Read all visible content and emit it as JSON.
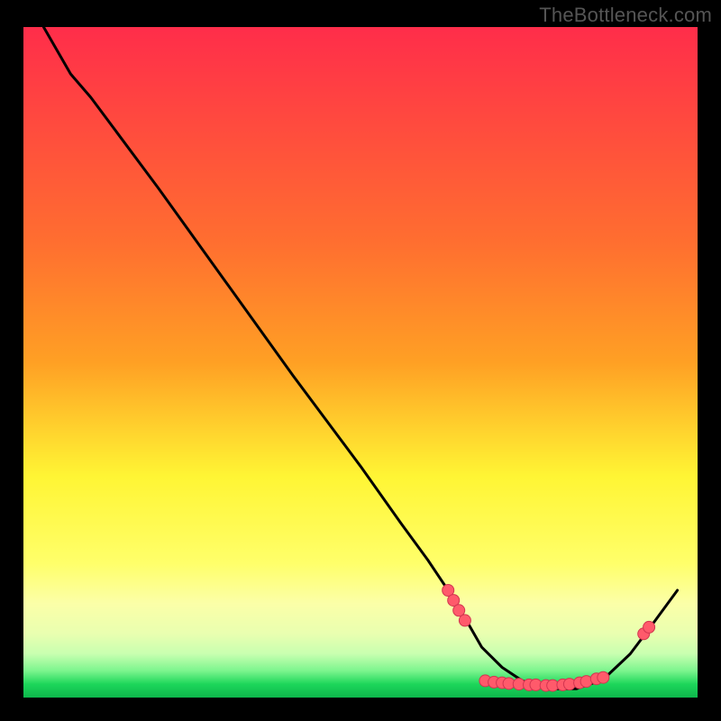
{
  "attribution": "TheBottleneck.com",
  "colors": {
    "black": "#000000",
    "top_red": "#ff2d4a",
    "orange": "#ffa024",
    "yellow": "#fff534",
    "pale_yellow": "#fbffa8",
    "pale_green": "#c8ffb0",
    "green": "#1dd65a",
    "curve": "#000000",
    "dot_fill": "#ff5a6b",
    "dot_stroke": "#d23550"
  },
  "chart_data": {
    "type": "line",
    "title": "",
    "xlabel": "",
    "ylabel": "",
    "xlim": [
      0,
      100
    ],
    "ylim": [
      0,
      100
    ],
    "curve": [
      {
        "x": 3,
        "y": 100
      },
      {
        "x": 7,
        "y": 93
      },
      {
        "x": 10,
        "y": 89.5
      },
      {
        "x": 20,
        "y": 76
      },
      {
        "x": 30,
        "y": 62
      },
      {
        "x": 40,
        "y": 48
      },
      {
        "x": 50,
        "y": 34.5
      },
      {
        "x": 56,
        "y": 26
      },
      {
        "x": 60,
        "y": 20.5
      },
      {
        "x": 63,
        "y": 16
      },
      {
        "x": 66,
        "y": 11
      },
      {
        "x": 68,
        "y": 7.5
      },
      {
        "x": 71,
        "y": 4.5
      },
      {
        "x": 74,
        "y": 2.5
      },
      {
        "x": 78,
        "y": 1.3
      },
      {
        "x": 82,
        "y": 1.3
      },
      {
        "x": 86,
        "y": 2.7
      },
      {
        "x": 90,
        "y": 6.5
      },
      {
        "x": 93,
        "y": 10.5
      },
      {
        "x": 97,
        "y": 16
      }
    ],
    "dot_clusters": [
      {
        "x": 63.0,
        "y": 16.0
      },
      {
        "x": 63.8,
        "y": 14.5
      },
      {
        "x": 64.6,
        "y": 13.0
      },
      {
        "x": 65.5,
        "y": 11.5
      },
      {
        "x": 68.5,
        "y": 2.5
      },
      {
        "x": 69.8,
        "y": 2.3
      },
      {
        "x": 71.0,
        "y": 2.2
      },
      {
        "x": 72.0,
        "y": 2.1
      },
      {
        "x": 73.5,
        "y": 2.0
      },
      {
        "x": 75.0,
        "y": 1.9
      },
      {
        "x": 76.0,
        "y": 1.9
      },
      {
        "x": 77.5,
        "y": 1.8
      },
      {
        "x": 78.5,
        "y": 1.8
      },
      {
        "x": 80.0,
        "y": 1.9
      },
      {
        "x": 81.0,
        "y": 2.0
      },
      {
        "x": 82.5,
        "y": 2.2
      },
      {
        "x": 83.5,
        "y": 2.4
      },
      {
        "x": 85.0,
        "y": 2.8
      },
      {
        "x": 86.0,
        "y": 3.0
      },
      {
        "x": 92.0,
        "y": 9.5
      },
      {
        "x": 92.8,
        "y": 10.5
      }
    ]
  }
}
